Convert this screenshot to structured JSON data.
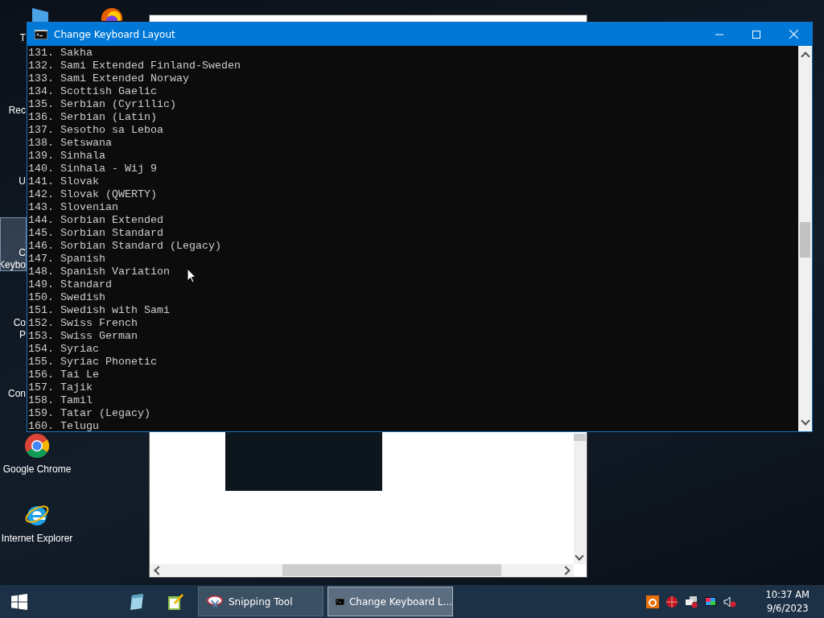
{
  "desktop_icons": [
    {
      "kind": "folder",
      "lines": [
        "T"
      ],
      "selected": false
    },
    {
      "kind": "blank",
      "lines": [
        "Rec"
      ],
      "selected": false
    },
    {
      "kind": "blank",
      "lines": [
        "U"
      ],
      "selected": false
    },
    {
      "kind": "blank",
      "lines": [
        "C",
        "Keybo"
      ],
      "selected": true
    },
    {
      "kind": "blank",
      "lines": [
        "Co",
        "P"
      ],
      "selected": false
    },
    {
      "kind": "blank",
      "lines": [
        "Con"
      ],
      "selected": false
    },
    {
      "kind": "chrome",
      "lines": [
        "Google Chrome"
      ],
      "selected": false
    },
    {
      "kind": "ie",
      "lines": [
        "Internet Explorer"
      ],
      "selected": false
    }
  ],
  "console": {
    "title": "Change Keyboard Layout",
    "lines": [
      "131. Sakha",
      "132. Sami Extended Finland-Sweden",
      "133. Sami Extended Norway",
      "134. Scottish Gaelic",
      "135. Serbian (Cyrillic)",
      "136. Serbian (Latin)",
      "137. Sesotho sa Leboa",
      "138. Setswana",
      "139. Sinhala",
      "140. Sinhala - Wij 9",
      "141. Slovak",
      "142. Slovak (QWERTY)",
      "143. Slovenian",
      "144. Sorbian Extended",
      "145. Sorbian Standard",
      "146. Sorbian Standard (Legacy)",
      "147. Spanish",
      "148. Spanish Variation",
      "149. Standard",
      "150. Swedish",
      "151. Swedish with Sami",
      "152. Swiss French",
      "153. Swiss German",
      "154. Syriac",
      "155. Syriac Phonetic",
      "156. Tai Le",
      "157. Tajik",
      "158. Tamil",
      "159. Tatar (Legacy)",
      "160. Telugu"
    ]
  },
  "taskbar": {
    "pinned": [
      {
        "kind": "notepad"
      },
      {
        "kind": "editor"
      }
    ],
    "buttons": [
      {
        "kind": "snipping",
        "label": "Snipping Tool",
        "selected": false
      },
      {
        "kind": "console",
        "label": "Change Keyboard L...",
        "selected": true
      }
    ],
    "tray": [
      {
        "kind": "a"
      },
      {
        "kind": "globe"
      },
      {
        "kind": "network"
      },
      {
        "kind": "display"
      },
      {
        "kind": "volume"
      }
    ],
    "time": "10:37 AM",
    "date": "9/6/2023"
  }
}
